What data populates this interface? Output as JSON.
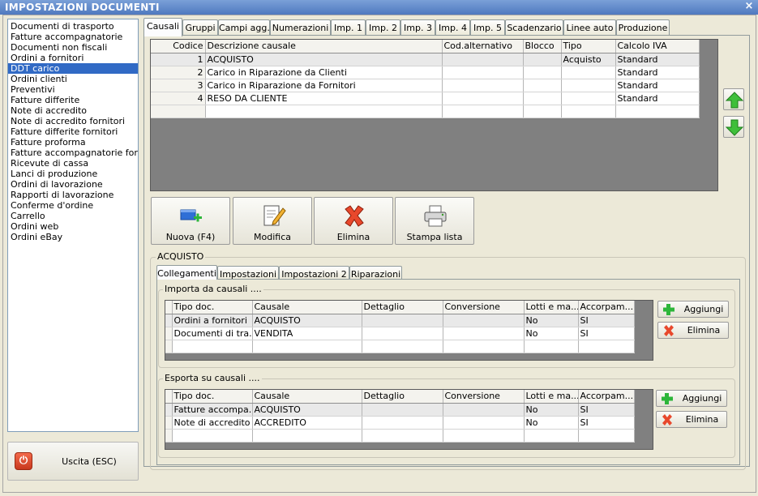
{
  "window": {
    "title": "IMPOSTAZIONI DOCUMENTI",
    "close_glyph": "×"
  },
  "doc_types": [
    "Documenti di trasporto",
    "Fatture accompagnatorie",
    "Documenti non fiscali",
    "Ordini a fornitori",
    "DDT carico",
    "Ordini clienti",
    "Preventivi",
    "Fatture differite",
    "Note di accredito",
    "Note di accredito fornitori",
    "Fatture differite fornitori",
    "Fatture proforma",
    "Fatture accompagnatorie fornito",
    "Ricevute di cassa",
    "Lanci di produzione",
    "Ordini di lavorazione",
    "Rapporti di lavorazione",
    "Conferme d'ordine",
    "Carrello",
    "Ordini web",
    "Ordini eBay"
  ],
  "selected_doc_type": "DDT carico",
  "exit_button": {
    "label": "Uscita (ESC)",
    "icon": "power-icon"
  },
  "tabs": [
    "Causali",
    "Gruppi",
    "Campi agg.",
    "Numerazioni",
    "Imp. 1",
    "Imp. 2",
    "Imp. 3",
    "Imp. 4",
    "Imp. 5",
    "Scadenzario",
    "Linee auto",
    "Produzione"
  ],
  "active_tab": "Causali",
  "causali": {
    "columns": [
      "Codice",
      "Descrizione causale",
      "Cod.alternativo",
      "Blocco",
      "Tipo",
      "Calcolo IVA"
    ],
    "rows": [
      {
        "codice": "1",
        "descrizione": "ACQUISTO",
        "cod_alt": "",
        "blocco": "",
        "tipo": "Acquisto",
        "calcolo_iva": "Standard"
      },
      {
        "codice": "2",
        "descrizione": "Carico in Riparazione da Clienti",
        "cod_alt": "",
        "blocco": "",
        "tipo": "",
        "calcolo_iva": "Standard"
      },
      {
        "codice": "3",
        "descrizione": "Carico in Riparazione da Fornitori",
        "cod_alt": "",
        "blocco": "",
        "tipo": "",
        "calcolo_iva": "Standard"
      },
      {
        "codice": "4",
        "descrizione": "RESO DA CLIENTE",
        "cod_alt": "",
        "blocco": "",
        "tipo": "",
        "calcolo_iva": "Standard"
      }
    ]
  },
  "actions": {
    "nuova": "Nuova (F4)",
    "modifica": "Modifica",
    "elimina": "Elimina",
    "stampa": "Stampa lista"
  },
  "detail": {
    "title": "ACQUISTO",
    "tabs": [
      "Collegamenti",
      "Impostazioni",
      "Impostazioni 2",
      "Riparazioni"
    ],
    "active_tab": "Collegamenti",
    "importa": {
      "title": "Importa da causali ....",
      "columns": [
        "Tipo doc.",
        "Causale",
        "Dettaglio",
        "Conversione",
        "Lotti e ma...",
        "Accorpam..."
      ],
      "rows": [
        [
          "Ordini a fornitori",
          "ACQUISTO",
          "",
          "",
          "No",
          "SI"
        ],
        [
          "Documenti di tra...",
          "VENDITA",
          "",
          "",
          "No",
          "SI"
        ]
      ],
      "add_label": "Aggiungi",
      "delete_label": "Elimina"
    },
    "esporta": {
      "title": "Esporta su causali ....",
      "columns": [
        "Tipo doc.",
        "Causale",
        "Dettaglio",
        "Conversione",
        "Lotti e ma...",
        "Accorpam..."
      ],
      "rows": [
        [
          "Fatture accompa...",
          "ACQUISTO",
          "",
          "",
          "No",
          "SI"
        ],
        [
          "Note di accredito",
          "ACCREDITO",
          "",
          "",
          "No",
          "SI"
        ]
      ],
      "add_label": "Aggiungi",
      "delete_label": "Elimina"
    }
  },
  "colors": {
    "selection": "#316ac5",
    "titlebar": "#4f79bf",
    "grid_bg": "#808080"
  }
}
